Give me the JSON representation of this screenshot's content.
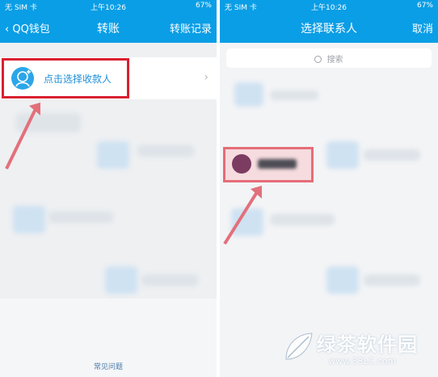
{
  "left_screen": {
    "status": {
      "carrier": "无 SIM 卡",
      "time": "上午10:26",
      "battery": "67%"
    },
    "nav": {
      "back_label": "QQ钱包",
      "title": "转账",
      "right_action": "转账记录"
    },
    "select_payee_label": "点击选择收款人",
    "faq_label": "常见问题"
  },
  "right_screen": {
    "status": {
      "carrier": "无 SIM 卡",
      "time": "上午10:26",
      "battery": "67%"
    },
    "nav": {
      "title": "选择联系人",
      "cancel_label": "取消"
    },
    "search": {
      "placeholder": "搜索"
    }
  },
  "watermark": {
    "title": "绿茶软件园",
    "url": "www.33LC.com"
  },
  "colors": {
    "header": "#0a9ee6",
    "highlight_border": "#d92030",
    "link_text": "#1e8fd6"
  }
}
